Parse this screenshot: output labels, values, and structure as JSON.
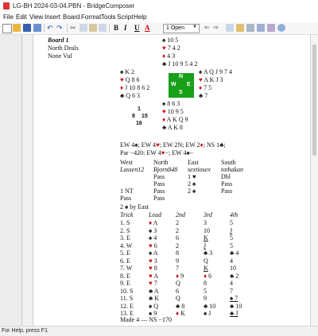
{
  "window": {
    "title": "LG-BH 2024-03-04.PBN - BridgeComposer"
  },
  "menu": [
    "File",
    "Edit",
    "View",
    "Insert",
    "Board",
    "Format",
    "Tools",
    "Script",
    "Help"
  ],
  "toolbar": {
    "font_combo": "1 Open",
    "bold": "B",
    "italic": "I",
    "underline": "U",
    "color": "A"
  },
  "board": {
    "title": "Board 1",
    "dealer": "North Deals",
    "vul": "None Vul",
    "north": {
      "spades": "10 5",
      "hearts": "7 4 2",
      "diamonds": "4 3",
      "clubs": "J 10 9 5 4 2"
    },
    "west": {
      "spades": "K 2",
      "hearts": "Q 8 6",
      "diamonds": "J 10 8 6 2",
      "clubs": "Q 6 3"
    },
    "east": {
      "spades": "A Q J 9 7 4",
      "hearts": "A K J 3",
      "diamonds": "7 5",
      "clubs": "7"
    },
    "south": {
      "spades": "8 6 3",
      "hearts": "10 9 5",
      "diamonds": "A K Q 9",
      "clubs": "A K 8"
    },
    "compass": {
      "n": "N",
      "w": "W",
      "e": "E",
      "s": "S"
    },
    "hcp": {
      "north": "1",
      "west": "8",
      "east": "15",
      "south": "16"
    }
  },
  "result_lines": [
    "EW 4♠; EW 4♥; EW 2N; EW 2♦; NS 1♣;",
    "Par −420: EW 4♥−; EW 4♠−"
  ],
  "auction": {
    "seats": [
      "West",
      "North",
      "East",
      "South"
    ],
    "players": [
      "Lassen12",
      "Bjorn848",
      "sextiosex",
      "tothakan"
    ],
    "rows": [
      [
        "",
        "Pass",
        "1 ♥",
        "Dbl"
      ],
      [
        "",
        "Pass",
        "2 ♠",
        "Pass"
      ],
      [
        "1 NT",
        "Pass",
        "2 ♠",
        "Pass"
      ],
      [
        "Pass",
        "Pass",
        "",
        ""
      ]
    ],
    "contract": "2 ♠ by East"
  },
  "play": {
    "headers": [
      "Trick",
      "Lead",
      "2nd",
      "3rd",
      "4th"
    ],
    "rows": [
      [
        "1. S",
        "♦ A",
        "2",
        "3",
        "5"
      ],
      [
        "2. S",
        "♠ 3",
        "2",
        "10",
        "J"
      ],
      [
        "3. E",
        "♠ 4",
        "6",
        "K",
        "5"
      ],
      [
        "4. W",
        "♥ 6",
        "2",
        "J",
        "5"
      ],
      [
        "5. E",
        "♠ A",
        "8",
        "♣ 3",
        "♣ 4"
      ],
      [
        "6. E",
        "♥ 3",
        "9",
        "Q",
        "4"
      ],
      [
        "7. W",
        "♥ 8",
        "7",
        "K",
        "10"
      ],
      [
        "8. E",
        "♥ A",
        "♦ 9",
        "♦ 6",
        "♣ 2"
      ],
      [
        "9. E",
        "♥ 7",
        "Q",
        "8",
        "4"
      ],
      [
        "10. S",
        "♣ A",
        "6",
        "5",
        "7"
      ],
      [
        "11. S",
        "♣ K",
        "Q",
        "9",
        "♠ 7"
      ],
      [
        "12. E",
        "♠ Q",
        "♣ 8",
        "♣ 10",
        "♣ 10"
      ],
      [
        "13. E",
        "♠ 9",
        "♦ K",
        "♠ J",
        "♣ J"
      ]
    ],
    "summary": "Made 4 — NS −170"
  },
  "status": {
    "text": "For Help, press F1"
  }
}
